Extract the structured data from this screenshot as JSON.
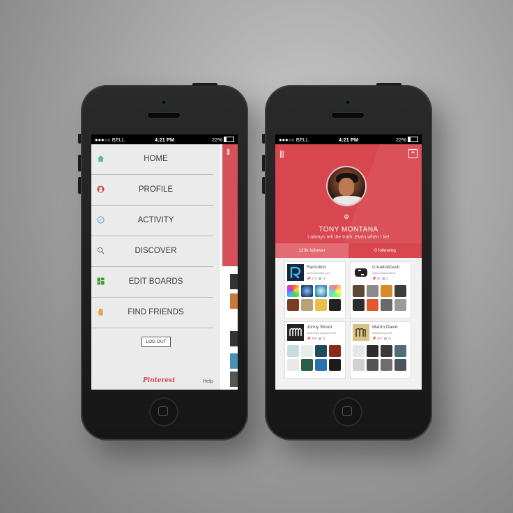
{
  "status_bar": {
    "carrier": "●●●○○ BELL",
    "time": "4:21 PM",
    "battery": "22%"
  },
  "menu": {
    "items": [
      {
        "label": "HOME",
        "icon": "home-icon",
        "color": "#5bb8a5"
      },
      {
        "label": "PROFILE",
        "icon": "profile-icon",
        "color": "#d34646"
      },
      {
        "label": "ACTIVITY",
        "icon": "compass-icon",
        "color": "#5ba7d8"
      },
      {
        "label": "DISCOVER",
        "icon": "search-icon",
        "color": "#777777"
      },
      {
        "label": "EDIT BOARDS",
        "icon": "boards-icon",
        "color": "#4a9a3c"
      },
      {
        "label": "FIND FRIENDS",
        "icon": "friends-icon",
        "color": "#e8a04a"
      }
    ],
    "logout_label": "LOG OUT",
    "brand": "Pinterest",
    "help_label": "Help"
  },
  "profile": {
    "name": "TONY MONTANA",
    "tagline": "I always tell the truth. Even when I lie!",
    "followers": "123k follower",
    "following": "0 following",
    "accent": "#d8474f"
  },
  "boards": [
    {
      "name": "Ramotion",
      "url": "www.ramotion.com",
      "pins": "670",
      "boards": "18"
    },
    {
      "name": "CreativeDash",
      "url": "www.creativeda.sh",
      "pins": "55",
      "boards": "3"
    },
    {
      "name": "Jonny Wood",
      "url": "www.mrjonnywood.com",
      "pins": "306",
      "boards": "11"
    },
    {
      "name": "Martin David",
      "url": "www.srcog.com",
      "pins": "467",
      "boards": "15"
    }
  ]
}
